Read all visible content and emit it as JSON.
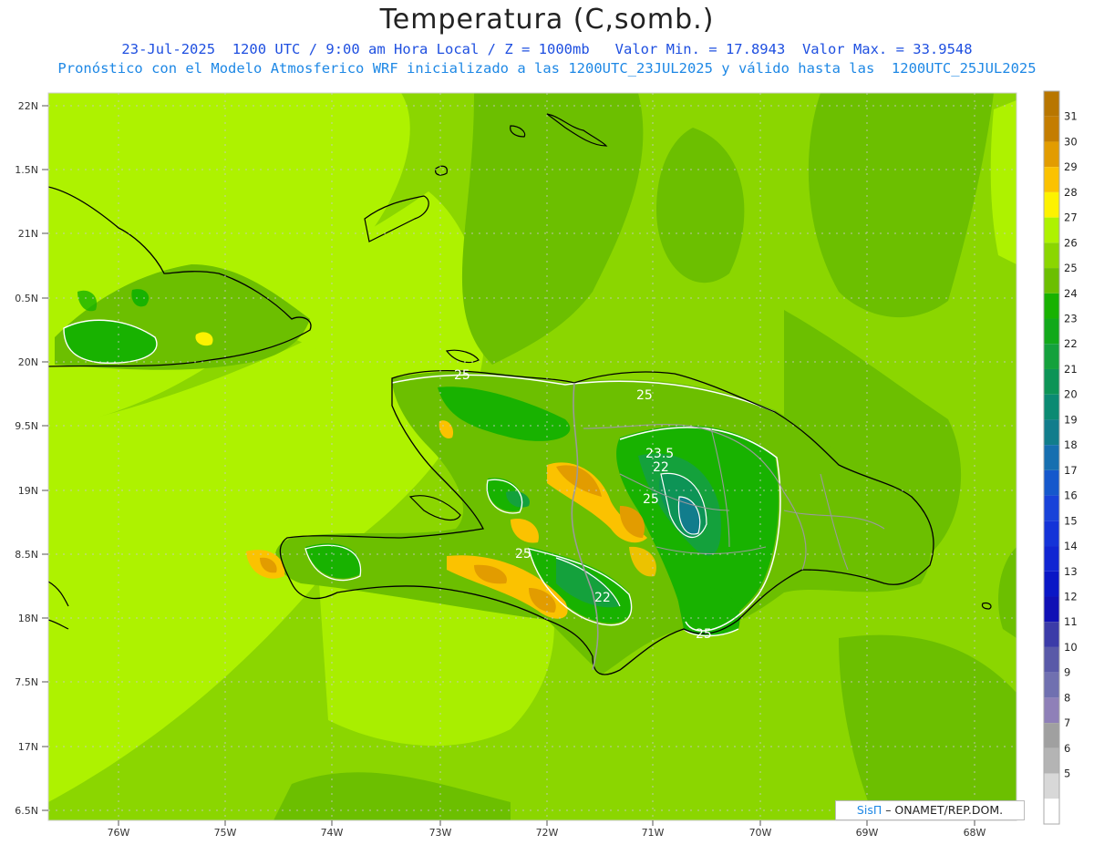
{
  "header": {
    "title": "Temperatura (C,somb.)",
    "line1": "23-Jul-2025  1200 UTC / 9:00 am Hora Local / Z = 1000mb   Valor Min. = 17.8943  Valor Max. = 33.9548",
    "line2": "Pronóstico con el Modelo Atmosferico WRF inicializado a las 1200UTC_23JUL2025 y válido hasta las  1200UTC_25JUL2025"
  },
  "axes": {
    "lat_labels": [
      "22N",
      "1.5N",
      "21N",
      "0.5N",
      "20N",
      "9.5N",
      "19N",
      "8.5N",
      "18N",
      "7.5N",
      "17N",
      "6.5N"
    ],
    "lon_labels": [
      "76W",
      "75W",
      "74W",
      "73W",
      "72W",
      "71W",
      "70W",
      "69W",
      "68W"
    ]
  },
  "contour_labels": [
    "25",
    "25",
    "23.5",
    "22",
    "25",
    "25",
    "22",
    "25"
  ],
  "colorbar": {
    "levels": [
      "31",
      "30",
      "29",
      "28",
      "27",
      "26",
      "25",
      "24",
      "23",
      "22",
      "21",
      "20",
      "19",
      "18",
      "17",
      "16",
      "15",
      "14",
      "13",
      "12",
      "11",
      "10",
      "9",
      "8",
      "7",
      "6",
      "5"
    ],
    "colors": [
      "#c47d00",
      "#e29c00",
      "#fbc200",
      "#fdf200",
      "#aef200",
      "#8bd600",
      "#6cbf00",
      "#18b200",
      "#12a91a",
      "#14a13c",
      "#0d9456",
      "#0b8a72",
      "#117d8c",
      "#166fb0",
      "#1558cc",
      "#1842d9",
      "#1433d8",
      "#1025d2",
      "#0a17c6",
      "#1010b5",
      "#3b3ba8",
      "#5959a8",
      "#7070b0",
      "#8f80b8",
      "#a0a0a0",
      "#b4b4b4",
      "#d8d8d8"
    ],
    "top_color": "#b87600",
    "bottom_color": "#ffffff"
  },
  "credit": {
    "sistema": "SisΠ",
    "org": " – ONAMET/REP.DOM."
  }
}
